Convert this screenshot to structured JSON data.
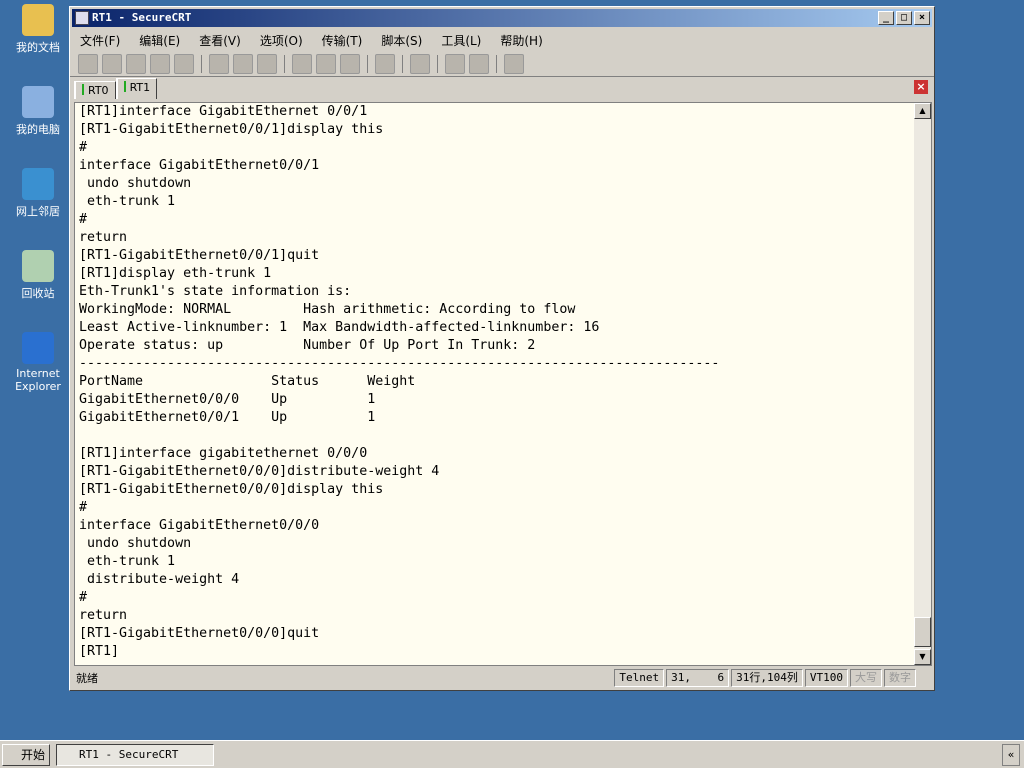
{
  "desktop": {
    "icons": [
      {
        "label": "我的文档",
        "color": "#e8c050"
      },
      {
        "label": "我的电脑",
        "color": "#8ab0e0"
      },
      {
        "label": "网上邻居",
        "color": "#3a90d0"
      },
      {
        "label": "回收站",
        "color": "#b0d0b0"
      },
      {
        "label": "Internet Explorer",
        "color": "#2a70d0"
      }
    ]
  },
  "window": {
    "title": "RT1 - SecureCRT",
    "controls": [
      "_",
      "□",
      "×"
    ]
  },
  "menu": [
    "文件(F)",
    "编辑(E)",
    "查看(V)",
    "选项(O)",
    "传输(T)",
    "脚本(S)",
    "工具(L)",
    "帮助(H)"
  ],
  "tabs": [
    {
      "label": "RT0"
    },
    {
      "label": "RT1",
      "active": true
    }
  ],
  "tab_close": "×",
  "terminal": {
    "lines": [
      "[RT1]interface GigabitEthernet 0/0/1",
      "[RT1-GigabitEthernet0/0/1]display this",
      "#",
      "interface GigabitEthernet0/0/1",
      " undo shutdown",
      " eth-trunk 1",
      "#",
      "return",
      "[RT1-GigabitEthernet0/0/1]quit",
      "[RT1]display eth-trunk 1",
      "Eth-Trunk1's state information is:",
      "WorkingMode: NORMAL         Hash arithmetic: According to flow",
      "Least Active-linknumber: 1  Max Bandwidth-affected-linknumber: 16",
      "Operate status: up          Number Of Up Port In Trunk: 2",
      "--------------------------------------------------------------------------------",
      "PortName                Status      Weight",
      "GigabitEthernet0/0/0    Up          1",
      "GigabitEthernet0/0/1    Up          1",
      "",
      "[RT1]interface gigabitethernet 0/0/0",
      "[RT1-GigabitEthernet0/0/0]distribute-weight 4",
      "[RT1-GigabitEthernet0/0/0]display this",
      "#",
      "interface GigabitEthernet0/0/0",
      " undo shutdown",
      " eth-trunk 1",
      " distribute-weight 4",
      "#",
      "return",
      "[RT1-GigabitEthernet0/0/0]quit",
      "[RT1]"
    ]
  },
  "status": {
    "ready": "就绪",
    "protocol": "Telnet",
    "cursor": "31,    6",
    "size": "31行,104列",
    "emulation": "VT100",
    "caps": "大写",
    "num": "数字"
  },
  "taskbar": {
    "start": "开始",
    "task": "RT1 - SecureCRT",
    "chevron": "«"
  }
}
